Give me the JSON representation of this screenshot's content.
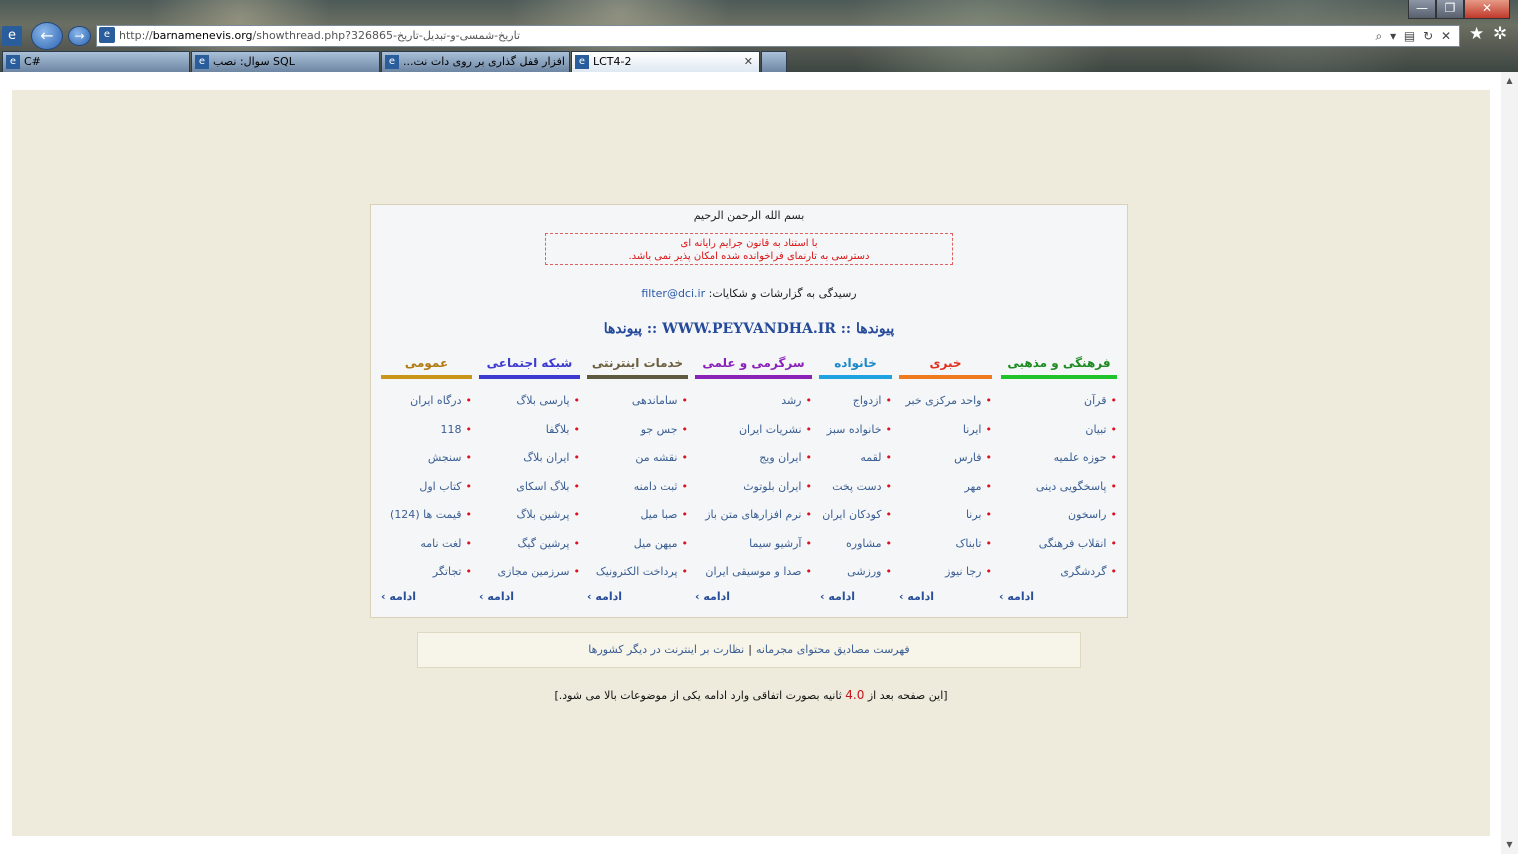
{
  "browser": {
    "url_domain": "barnamenevis.org",
    "url_prefix": "http://",
    "url_path": "/showthread.php?326865-تاریخ-شمسی-و-تبدیل-تاریخ",
    "address_tools": "⌕ ▾ ▤ ↻ ✕",
    "tabs": [
      {
        "label": "C#",
        "active": false
      },
      {
        "label": "سوال: نصب SQL",
        "active": false
      },
      {
        "label": "...نرم افزار قفل گذاری بر روی دات نت",
        "active": false
      },
      {
        "label": "LCT4-2",
        "active": true
      }
    ],
    "tab_close": "✕",
    "window_buttons": [
      "—",
      "❐",
      "✕"
    ],
    "toolbar_icons": [
      "★",
      "✲"
    ]
  },
  "page": {
    "bismillah": "بسم الله الرحمن الرحیم",
    "warning_line1": "با استناد به قانون جرایم رایانه ای",
    "warning_line2": "دسترسی به تارنمای فراخوانده شده امکان پذیر نمی باشد.",
    "contact_label": "رسیدگی به گزارشات و شکایات:",
    "contact_email": "filter@dci.ir",
    "site_title": "پیوندها :: WWW.PEYVANDHA.IR :: پیوندها",
    "more_label": "ادامه ›",
    "columns": [
      {
        "title": "فرهنگی و مذهبی",
        "color": "#22c32a",
        "title_color": "#1d8a22",
        "items": [
          "قرآن",
          "تبیان",
          "حوزه علمیه",
          "پاسخگویی دینی",
          "راسخون",
          "انقلاب فرهنگی",
          "گردشگری"
        ]
      },
      {
        "title": "خبری",
        "color": "#f07a1e",
        "title_color": "#e0301c",
        "items": [
          "واحد مرکزی خبر",
          "ایرنا",
          "فارس",
          "مهر",
          "برنا",
          "تابناک",
          "رجا نیوز"
        ]
      },
      {
        "title": "خانواده",
        "color": "#1fa2e0",
        "title_color": "#1a88c9",
        "items": [
          "ازدواج",
          "خانواده سبز",
          "لقمه",
          "دست پخت",
          "کودکان ایران",
          "مشاوره",
          "ورزشی"
        ]
      },
      {
        "title": "سرگرمی و علمی",
        "color": "#8a22b8",
        "title_color": "#8a22b8",
        "items": [
          "رشد",
          "نشریات ایران",
          "ایران ویج",
          "ایران بلوتوث",
          "نرم افزارهای متن باز",
          "آرشیو سیما",
          "صدا و موسیقی ایران"
        ]
      },
      {
        "title": "خدمات اینترنتی",
        "color": "#5e5a40",
        "title_color": "#6b5f3e",
        "items": [
          "ساماندهی",
          "جس جو",
          "نقشه من",
          "ثبت دامنه",
          "صبا میل",
          "میهن میل",
          "پرداخت الکترونیک"
        ]
      },
      {
        "title": "شبکه اجتماعی",
        "color": "#3d3ad1",
        "title_color": "#3d3ad1",
        "items": [
          "پارسی بلاگ",
          "بلاگفا",
          "ایران بلاگ",
          "بلاگ اسکای",
          "پرشین بلاگ",
          "پرشین گیگ",
          "سرزمین مجازی"
        ]
      },
      {
        "title": "عمومی",
        "color": "#c9961a",
        "title_color": "#b07a12",
        "items": [
          "درگاه ایران",
          "118",
          "سنجش",
          "کتاب اول",
          "قیمت ها (124)",
          "لغت نامه",
          "تجاتگر"
        ]
      }
    ],
    "links_box": {
      "item1": "فهرست مصادیق محتوای مجرمانه",
      "separator": "|",
      "item2": "نظارت بر اینترنت در دیگر کشورها"
    },
    "timer_before": "[این صفحه بعد از",
    "timer_value": "4.0",
    "timer_after": "ثانیه بصورت اتفاقی وارد ادامه یکی از موضوعات بالا می شود.]"
  }
}
